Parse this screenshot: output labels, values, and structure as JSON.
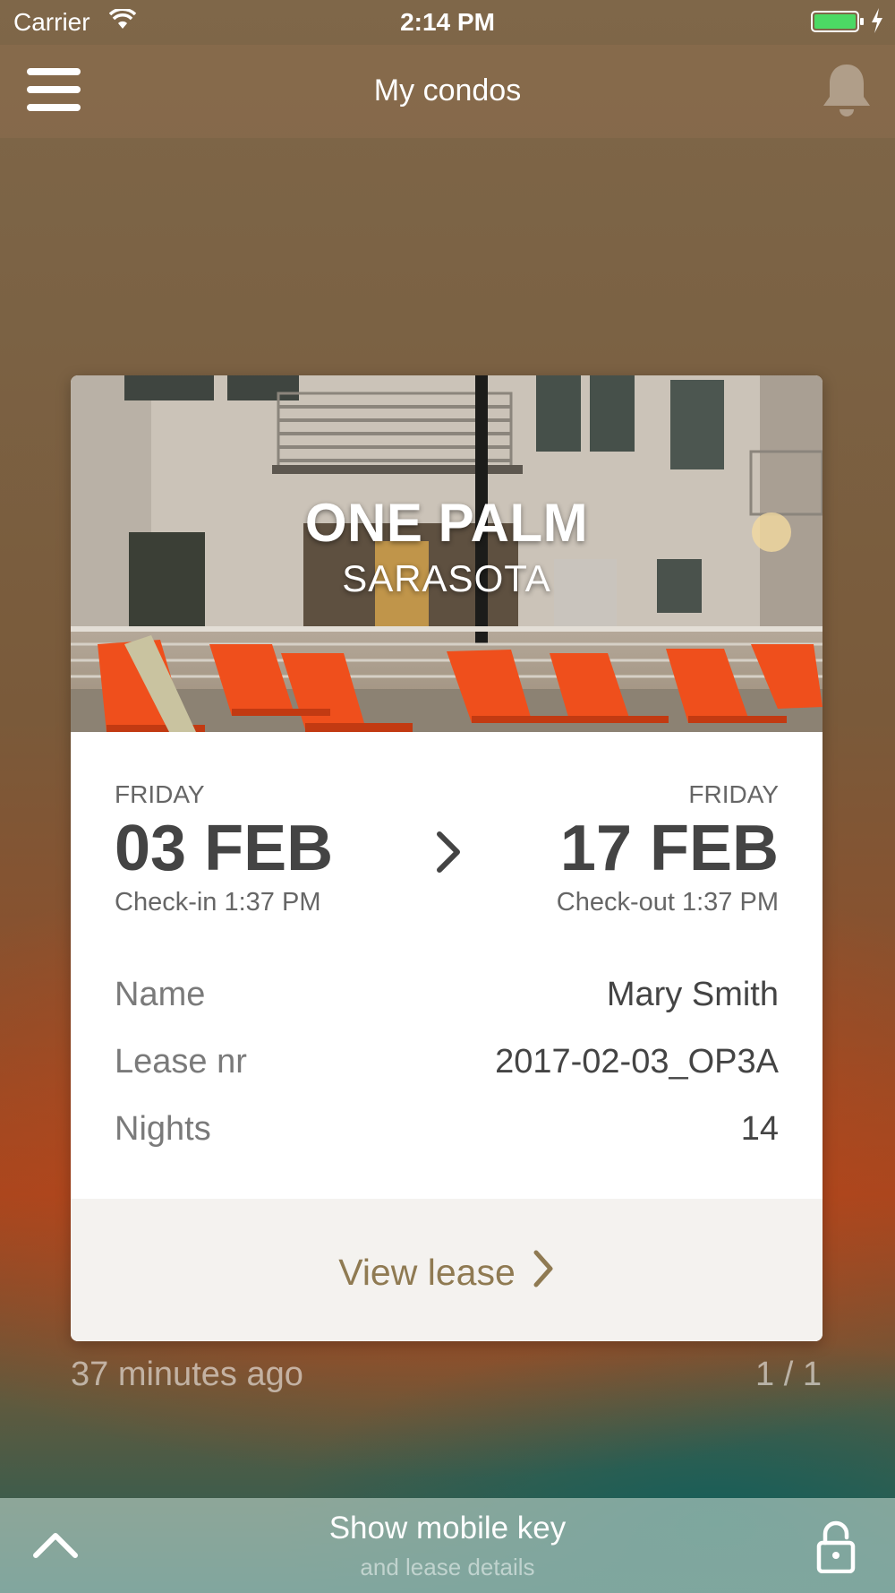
{
  "status_bar": {
    "carrier": "Carrier",
    "time": "2:14 PM",
    "icons": [
      "wifi-icon",
      "battery-icon",
      "charging-bolt-icon"
    ],
    "battery_color": "#4cd964"
  },
  "nav": {
    "title": "My condos",
    "left_icon": "hamburger-menu-icon",
    "right_icon": "bell-icon"
  },
  "card": {
    "property_name": "ONE PALM",
    "property_city": "SARASOTA",
    "checkin": {
      "day": "FRIDAY",
      "date": "03 FEB",
      "time": "Check-in 1:37 PM"
    },
    "checkout": {
      "day": "FRIDAY",
      "date": "17 FEB",
      "time": "Check-out 1:37 PM"
    },
    "details": [
      {
        "label": "Name",
        "value": "Mary Smith"
      },
      {
        "label": "Lease nr",
        "value": "2017-02-03_OP3A"
      },
      {
        "label": "Nights",
        "value": "14"
      }
    ],
    "view_lease_label": "View lease"
  },
  "footer_info": {
    "updated": "37 minutes ago",
    "page": "1 / 1"
  },
  "bottom_bar": {
    "title": "Show mobile key",
    "subtitle": "and lease details",
    "left_icon": "chevron-up-icon",
    "right_icon": "lock-icon"
  },
  "colors": {
    "accent": "#8f7a52",
    "text_dark": "#444444",
    "text_muted": "#7a7a7a",
    "lounger_orange": "#ef4f1c"
  }
}
